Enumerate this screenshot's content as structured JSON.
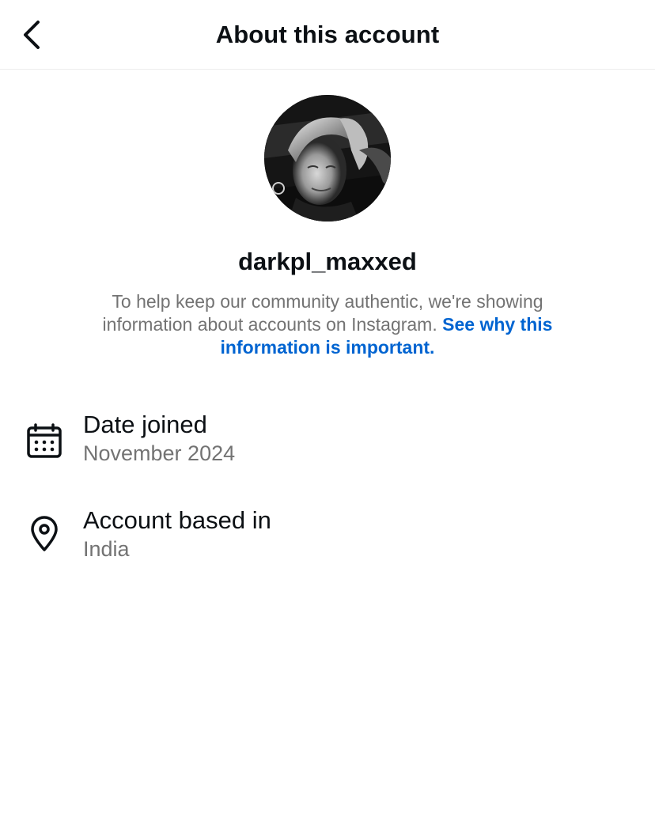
{
  "header": {
    "title": "About this account",
    "back_icon": "chevron-left-icon"
  },
  "profile": {
    "username": "darkpl_maxxed",
    "avatar": "avatar-photo"
  },
  "info": {
    "text": "To help keep our community authentic, we're showing information about accounts on Instagram.",
    "link": "See why this information is important."
  },
  "details": [
    {
      "icon": "calendar-icon",
      "label": "Date joined",
      "value": "November 2024"
    },
    {
      "icon": "location-pin-icon",
      "label": "Account based in",
      "value": "India"
    }
  ],
  "colors": {
    "link": "#0064d1",
    "secondary_text": "#737373",
    "primary_text": "#0c1014"
  }
}
